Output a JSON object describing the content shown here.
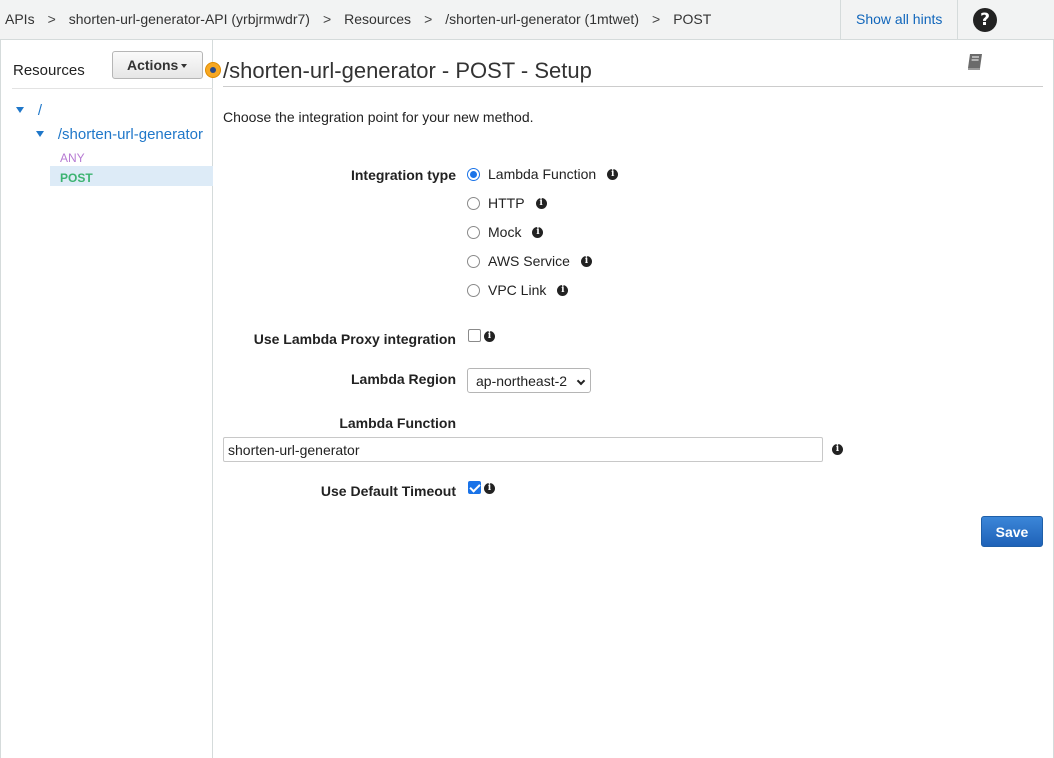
{
  "breadcrumb": {
    "apis": "APIs",
    "api_name": "shorten-url-generator-API (yrbjrmwdr7)",
    "resources": "Resources",
    "resource_path": "/shorten-url-generator (1mtwet)",
    "method": "POST",
    "separator": ">"
  },
  "header": {
    "hints_link": "Show all hints",
    "help_glyph": "?"
  },
  "sidebar": {
    "title": "Resources",
    "actions_label": "Actions",
    "tree": {
      "root": "/",
      "resource": "/shorten-url-generator",
      "methods": [
        "ANY",
        "POST"
      ]
    }
  },
  "main": {
    "title": "/shorten-url-generator - POST - Setup",
    "intro": "Choose the integration point for your new method.",
    "integration_type_label": "Integration type",
    "integration_options": [
      {
        "label": "Lambda Function",
        "checked": true
      },
      {
        "label": "HTTP",
        "checked": false
      },
      {
        "label": "Mock",
        "checked": false
      },
      {
        "label": "AWS Service",
        "checked": false
      },
      {
        "label": "VPC Link",
        "checked": false
      }
    ],
    "proxy_label": "Use Lambda Proxy integration",
    "proxy_checked": false,
    "region_label": "Lambda Region",
    "region_value": "ap-northeast-2",
    "function_label": "Lambda Function",
    "function_value": "shorten-url-generator",
    "timeout_label": "Use Default Timeout",
    "timeout_checked": true,
    "save_label": "Save",
    "info_glyph": "i"
  },
  "colors": {
    "link": "#1f77c9",
    "method_any": "#b77bd3",
    "method_post": "#3cb371",
    "primary_button": "#1f62b8"
  }
}
